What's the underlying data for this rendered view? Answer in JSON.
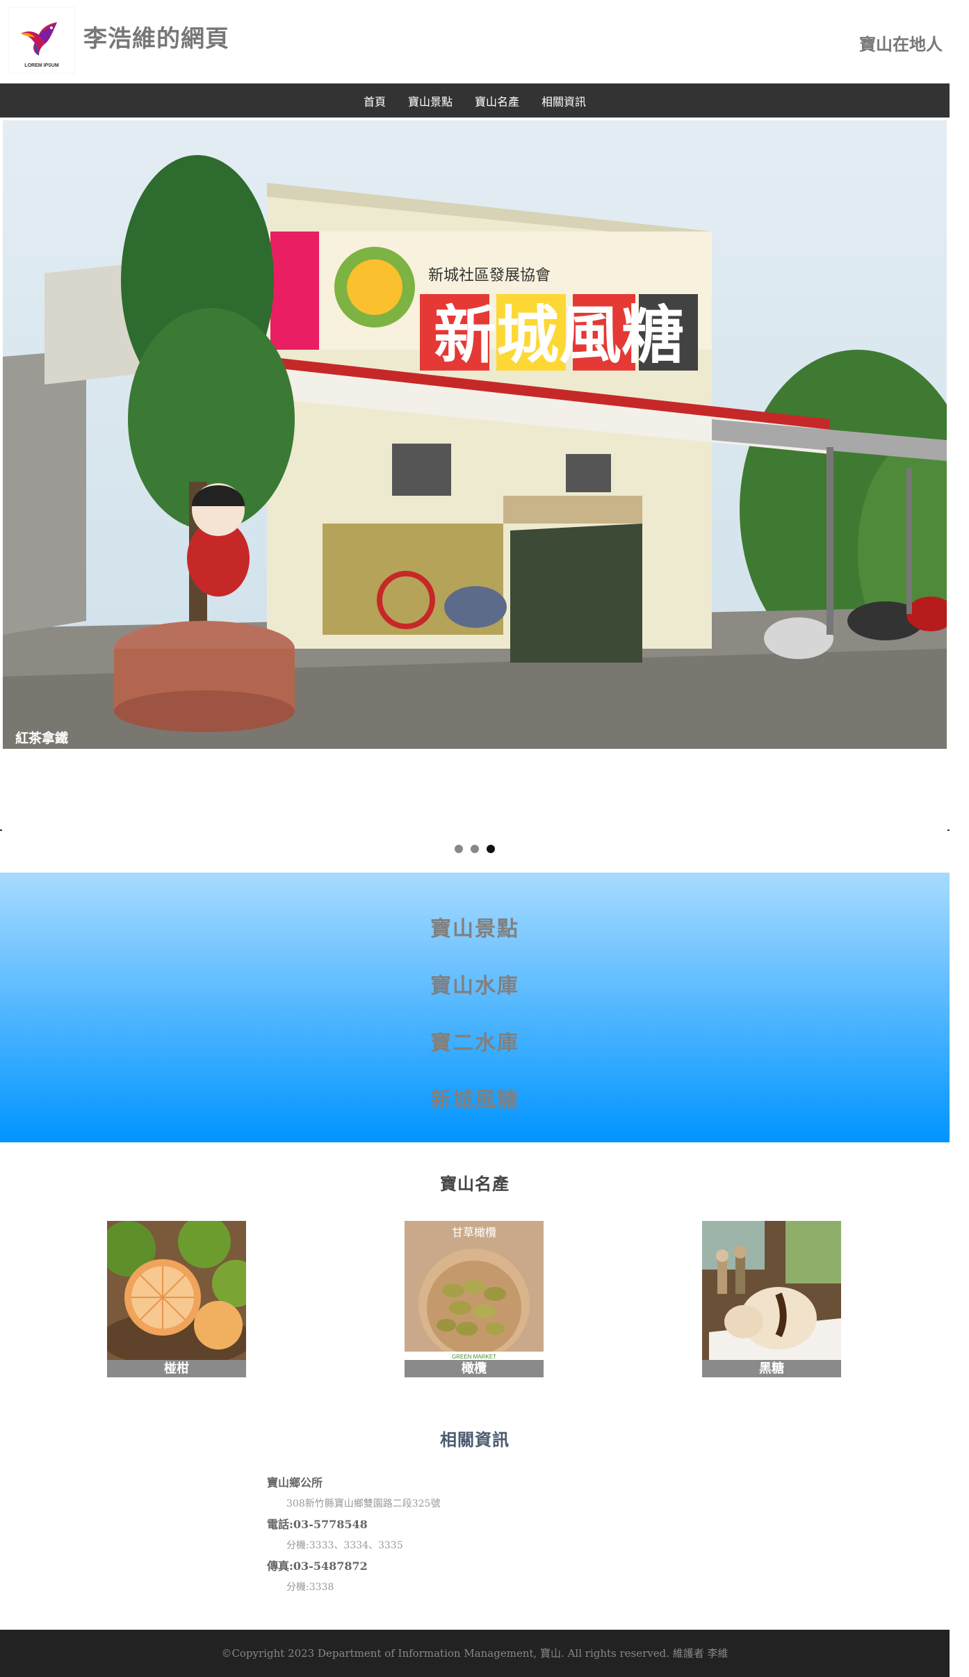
{
  "header": {
    "logo_text": "LOREM IPSUM",
    "title": "李浩維的網頁",
    "tagline": "寶山在地人"
  },
  "nav": {
    "items": [
      {
        "label": "首頁"
      },
      {
        "label": "寶山景點"
      },
      {
        "label": "寶山名產"
      },
      {
        "label": "相關資訊"
      }
    ]
  },
  "carousel": {
    "sign_main": "新城風糖",
    "sign_sub": "新城社區發展協會",
    "photo_credit": "紅茶拿鐵",
    "dots": 3,
    "active_dot": 3
  },
  "spots": {
    "items": [
      {
        "label": "寶山景點"
      },
      {
        "label": "寶山水庫"
      },
      {
        "label": "寶二水庫"
      },
      {
        "label": "新城風糖"
      }
    ]
  },
  "products": {
    "title": "寶山名產",
    "items": [
      {
        "caption": "椪柑"
      },
      {
        "caption": "橄欖",
        "image_text": "甘草橄欖",
        "image_brand": "GREEN MARKET"
      },
      {
        "caption": "黑糖"
      }
    ]
  },
  "info": {
    "title": "相關資訊",
    "office_label": "寶山鄉公所",
    "address": "308新竹縣寶山鄉雙園路二段325號",
    "phone_label": "電話:03-5778548",
    "phone_ext": "分機:3333、3334、3335",
    "fax_label": "傳真:03-5487872",
    "fax_ext": "分機:3338"
  },
  "footer": {
    "text": "©Copyright 2023 Department of Information Management, 寶山. All rights reserved. 維護者 李維"
  },
  "colors": {
    "navbar": "#333333",
    "spots_gradient_top": "#a8dbff",
    "spots_gradient_bottom": "#0094ff",
    "footer": "#222222"
  }
}
